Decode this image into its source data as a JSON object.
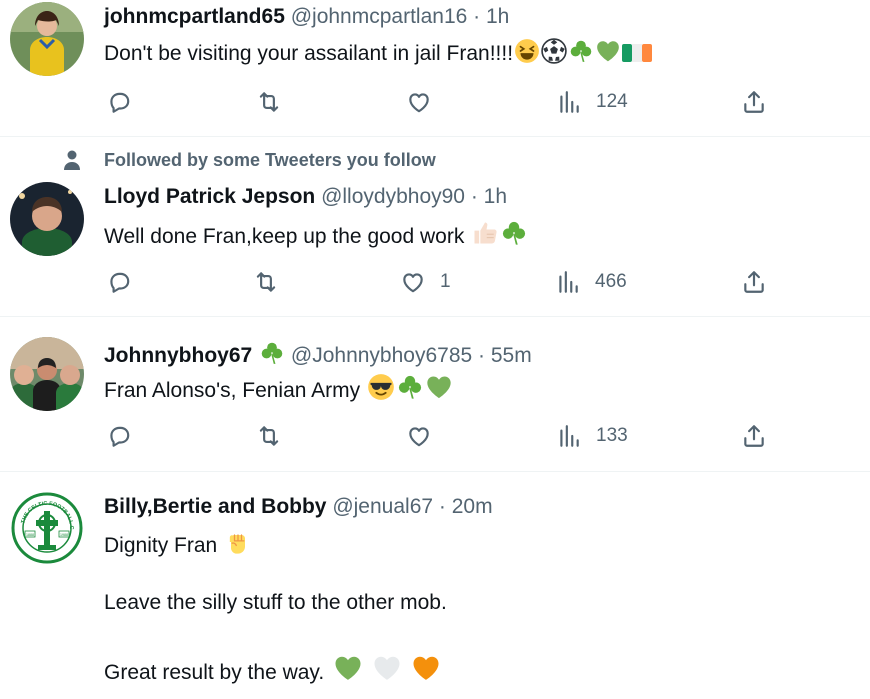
{
  "tweets": [
    {
      "name": "johnmcpartland65",
      "handle": "@johnmcpartlan16",
      "time": "1h",
      "text": "Don't be visiting your assailant in jail Fran!!!!",
      "emojis": [
        "grinning-squinting-face",
        "soccer-ball",
        "shamrock",
        "green-heart",
        "ireland-flag"
      ],
      "likes": "",
      "views": "124"
    },
    {
      "social_context": "Followed by some Tweeters you follow",
      "name": "Lloyd Patrick Jepson",
      "handle": "@lloydybhoy90",
      "time": "1h",
      "text": "Well done Fran,keep up the good work",
      "emojis": [
        "thumbs-up-light-skin",
        "shamrock"
      ],
      "likes": "1",
      "views": "466"
    },
    {
      "name": "Johnnybhoy67",
      "name_emoji": "shamrock",
      "handle": "@Johnnybhoy6785",
      "time": "55m",
      "text": "Fran Alonso's, Fenian Army",
      "emojis": [
        "smiling-face-with-sunglasses",
        "shamrock",
        "green-heart"
      ],
      "likes": "",
      "views": "133"
    },
    {
      "name": "Billy,Bertie and Bobby",
      "handle": "@jenual67",
      "time": "20m",
      "avatar_text": "THE CELTIC FOOTBALL CLUB",
      "avatar_years": [
        "1888",
        "1988"
      ],
      "lines": [
        "Dignity Fran",
        "Leave the silly stuff to the other mob.",
        "Great result by the way."
      ],
      "line_emojis": [
        [
          "raised-fist"
        ],
        [],
        [
          "green-heart",
          "white-heart",
          "orange-heart"
        ]
      ]
    }
  ],
  "colors": {
    "text": "#0f1419",
    "secondary": "#536471",
    "divider": "#eff3f4",
    "celtic_green": "#1b8a3c"
  }
}
